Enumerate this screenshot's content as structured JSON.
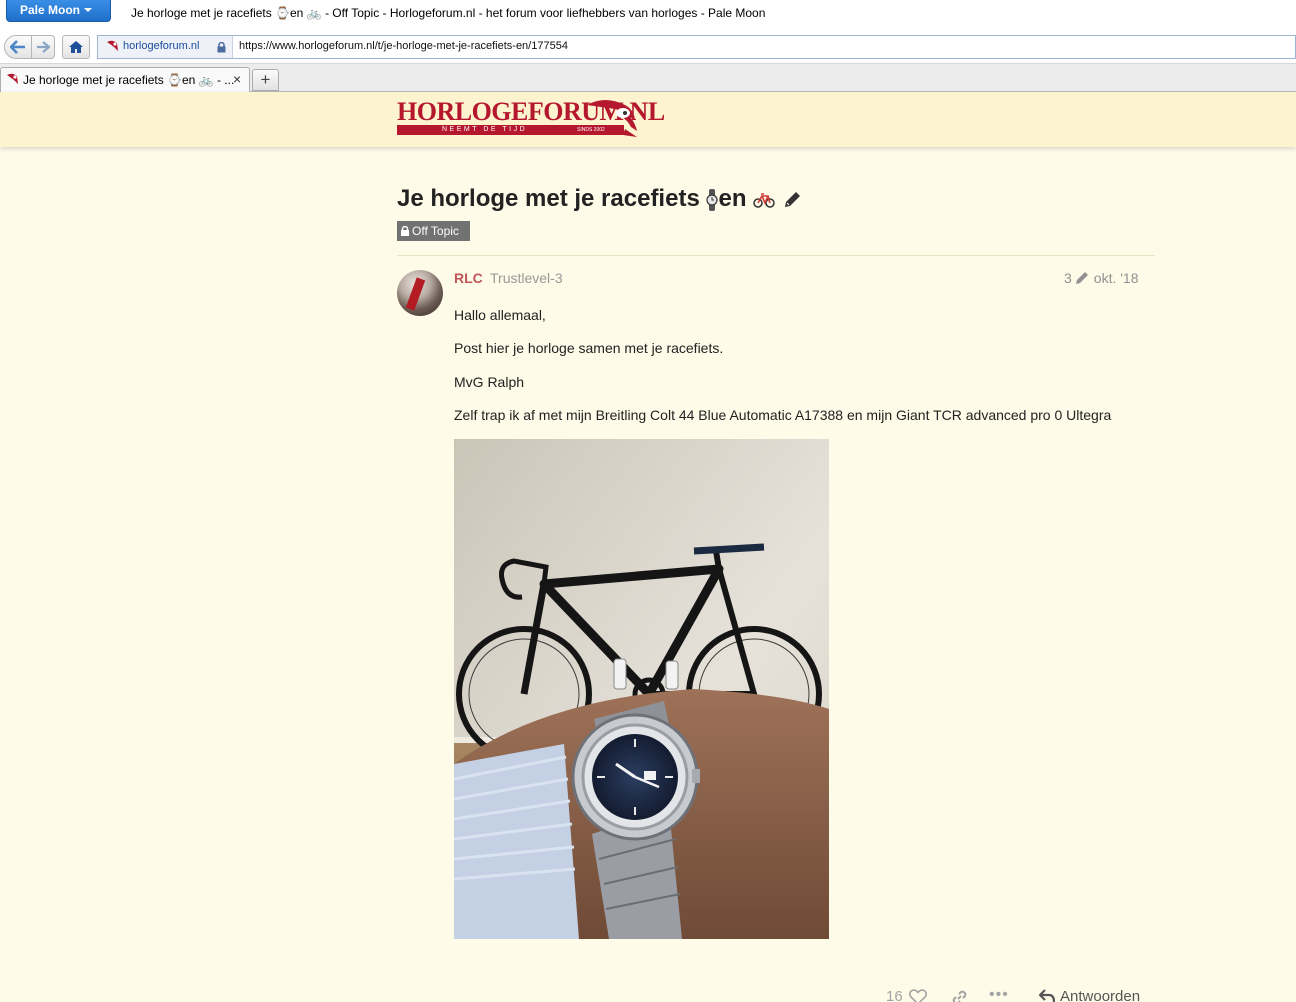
{
  "browser": {
    "app_button": "Pale Moon",
    "window_title": "Je horloge met je racefiets ⌚en 🚲 - Off Topic - Horlogeforum.nl - het forum voor liefhebbers van horloges - Pale Moon",
    "site_identity": "horlogeforum.nl",
    "url": "https://www.horlogeforum.nl/t/je-horloge-met-je-racefiets-en/177554",
    "tab_label": "Je horloge met je racefiets ⌚en 🚲 - ...",
    "tab_close": "×",
    "new_tab": "+"
  },
  "site": {
    "logo_name": "HORLOGEFORUM.NL",
    "logo_tagline": "NEEMT DE TIJD",
    "logo_since": "SINDS 2002"
  },
  "topic": {
    "title": "Je horloge met je racefiets",
    "title_suffix": "en",
    "category": "Off Topic"
  },
  "post": {
    "username": "RLC",
    "user_title": "Trustlevel-3",
    "edit_count": "3",
    "date": "okt. '18",
    "lines": [
      "Hallo allemaal,",
      "Post hier je horloge samen met je racefiets.",
      "MvG Ralph",
      "Zelf trap ik af met mijn Breitling Colt 44 Blue Automatic A17388 en mijn Giant TCR advanced pro 0 Ultegra"
    ],
    "like_count": "16",
    "more": "•••",
    "reply_label": "Antwoorden"
  },
  "icons": {
    "back": "arrow-left-icon",
    "forward": "arrow-right-icon",
    "home": "home-icon",
    "lock": "lock-icon",
    "watch": "watch-icon",
    "bicycle": "bicycle-icon",
    "pencil": "pencil-icon",
    "heart": "heart-icon",
    "link": "link-icon",
    "reply": "reply-icon"
  },
  "colors": {
    "header_bg": "#fdf3cf",
    "page_bg": "#fefbe8",
    "brand_red": "#b4172e",
    "username": "#c1575b",
    "badge": "#727272"
  }
}
